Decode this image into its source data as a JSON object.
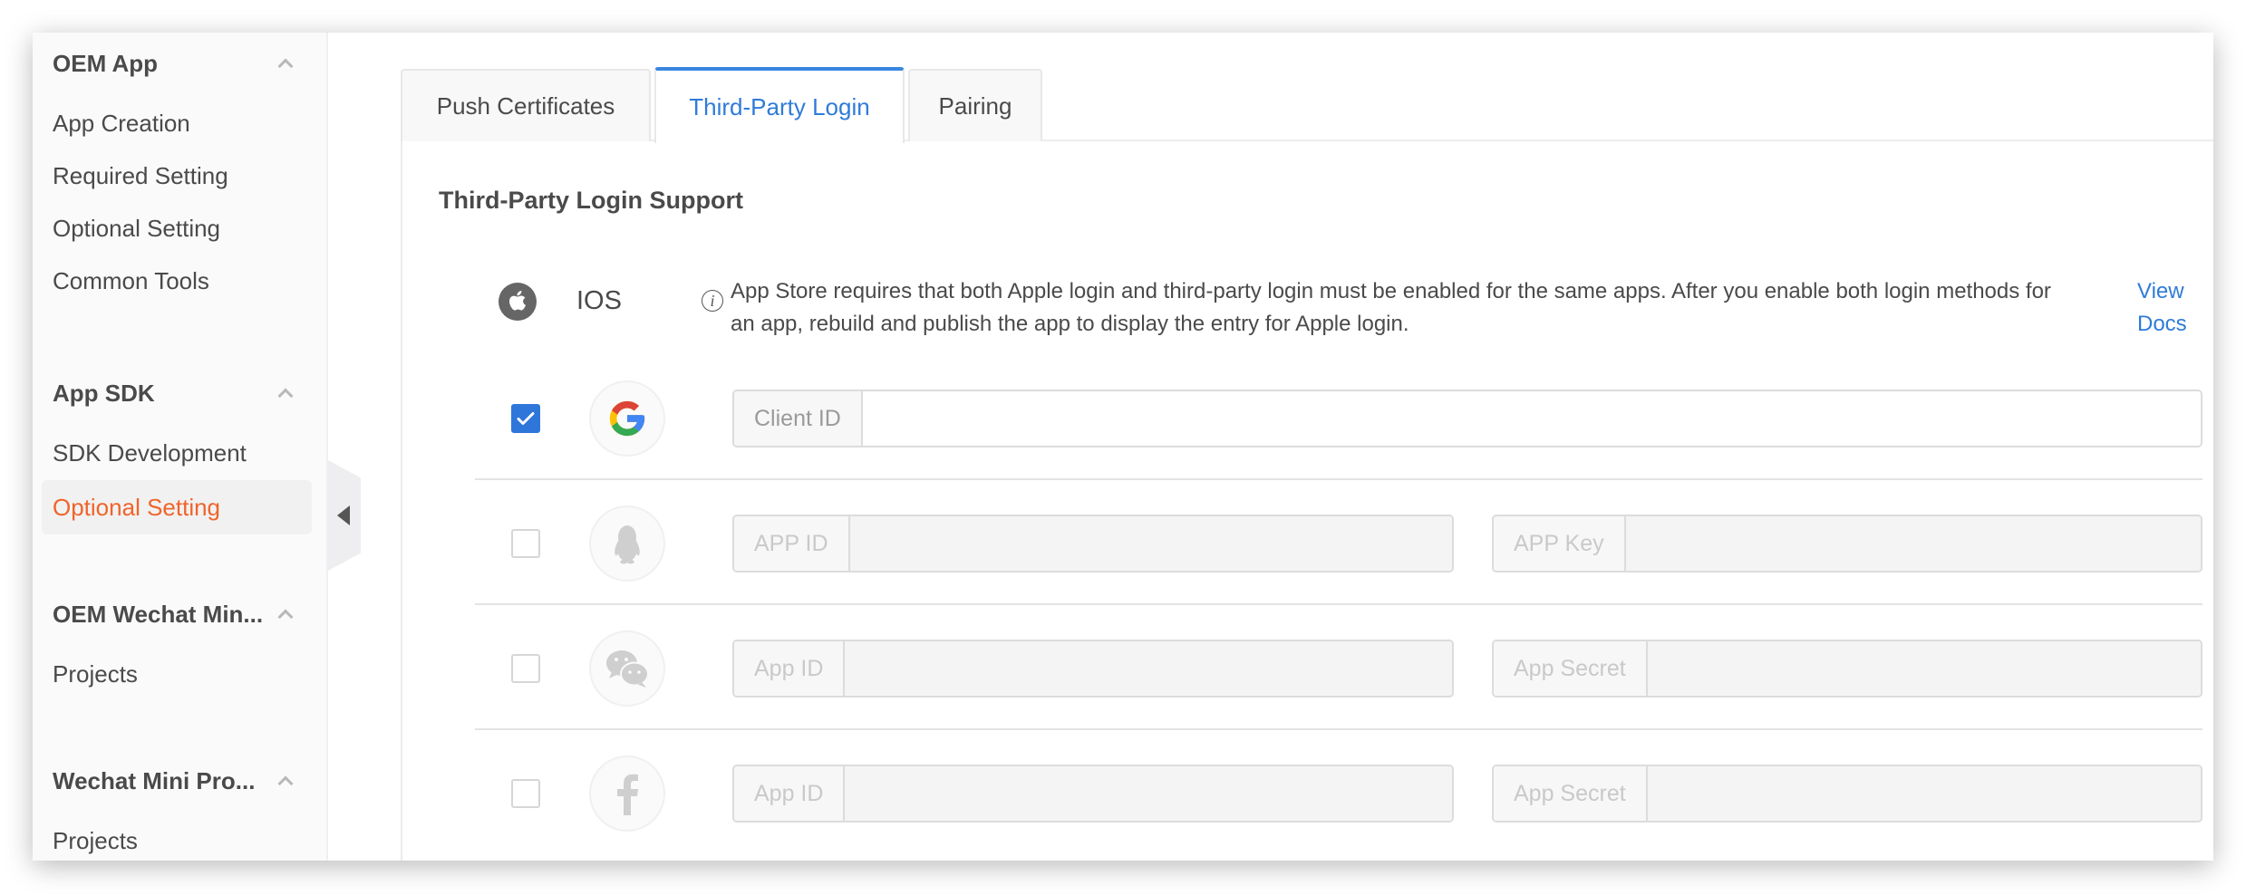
{
  "sidebar": {
    "groups": [
      {
        "title": "OEM App",
        "items": [
          "App Creation",
          "Required Setting",
          "Optional Setting",
          "Common Tools"
        ]
      },
      {
        "title": "App SDK",
        "items": [
          "SDK Development",
          "Optional Setting"
        ]
      },
      {
        "title": "OEM Wechat Min...",
        "items": [
          "Projects"
        ]
      },
      {
        "title": "Wechat Mini Pro...",
        "items": [
          "Projects"
        ]
      }
    ],
    "active_item": "App SDK / Optional Setting"
  },
  "tabs": [
    {
      "label": "Push Certificates",
      "active": false
    },
    {
      "label": "Third-Party Login",
      "active": true
    },
    {
      "label": "Pairing",
      "active": false
    }
  ],
  "section": {
    "title": "Third-Party Login Support"
  },
  "ios": {
    "icon": "apple-icon",
    "label": "IOS",
    "info_icon": "info-icon",
    "description": "App Store requires that both Apple login and third-party login must be enabled for the same apps. After you enable both login methods for an app, rebuild and publish the app to display the entry for Apple login.",
    "link_label": "View Docs"
  },
  "providers": [
    {
      "name": "Google",
      "icon": "google-icon",
      "checked": true,
      "fields": [
        {
          "label": "Client ID",
          "value": ""
        }
      ]
    },
    {
      "name": "QQ",
      "icon": "qq-penguin-icon",
      "checked": false,
      "fields": [
        {
          "label": "APP ID",
          "value": ""
        },
        {
          "label": "APP Key",
          "value": ""
        }
      ]
    },
    {
      "name": "WeChat",
      "icon": "wechat-icon",
      "checked": false,
      "fields": [
        {
          "label": "App ID",
          "value": ""
        },
        {
          "label": "App Secret",
          "value": ""
        }
      ]
    },
    {
      "name": "Facebook",
      "icon": "facebook-icon",
      "checked": false,
      "fields": [
        {
          "label": "App ID",
          "value": ""
        },
        {
          "label": "App Secret",
          "value": ""
        }
      ]
    }
  ],
  "colors": {
    "accent_blue": "#2f7bd8",
    "active_nav_orange": "#f0642b",
    "checkbox_blue": "#2f76da"
  }
}
